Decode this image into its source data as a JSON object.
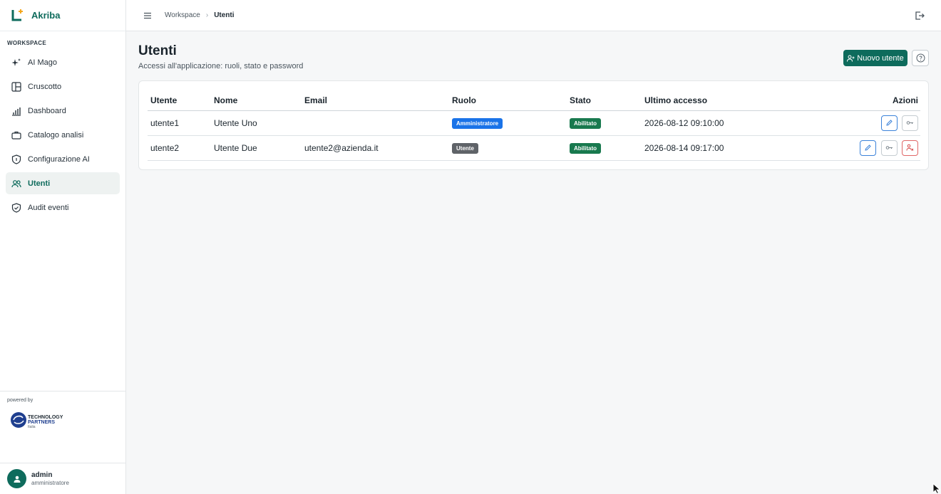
{
  "brand": {
    "name": "Akriba"
  },
  "sidebar": {
    "section": "WORKSPACE",
    "items": [
      {
        "label": "AI Mago",
        "icon": "sparkle-icon"
      },
      {
        "label": "Cruscotto",
        "icon": "layout-icon"
      },
      {
        "label": "Dashboard",
        "icon": "chart-icon"
      },
      {
        "label": "Catalogo analisi",
        "icon": "briefcase-icon"
      },
      {
        "label": "Configurazione AI",
        "icon": "shield-icon"
      },
      {
        "label": "Utenti",
        "icon": "users-icon"
      },
      {
        "label": "Audit eventi",
        "icon": "shield-check-icon"
      }
    ],
    "powered_by": "powered by",
    "partner_logo": "TECHNOLOGY PARTNERS Italia",
    "user": {
      "name": "admin",
      "role": "amministratore"
    }
  },
  "topbar": {
    "breadcrumb": [
      "Workspace",
      "Utenti"
    ]
  },
  "page": {
    "title": "Utenti",
    "subtitle": "Accessi all'applicazione: ruoli, stato e password",
    "new_user_label": "Nuovo utente"
  },
  "table": {
    "headers": [
      "Utente",
      "Nome",
      "Email",
      "Ruolo",
      "Stato",
      "Ultimo accesso",
      "Azioni"
    ],
    "rows": [
      {
        "username": "utente1",
        "name": "Utente Uno",
        "email": "",
        "role": "Amministratore",
        "status": "Abilitato",
        "last_access": "2026-08-12 09:10:00"
      },
      {
        "username": "utente2",
        "name": "Utente Due",
        "email": "utente2@azienda.it",
        "role": "Utente",
        "status": "Abilitato",
        "last_access": "2026-08-14 09:17:00"
      }
    ]
  },
  "colors": {
    "accent": "#0e6b5c",
    "admin_badge": "#1a73e8",
    "user_badge": "#5f6368",
    "status_badge": "#18794e"
  }
}
